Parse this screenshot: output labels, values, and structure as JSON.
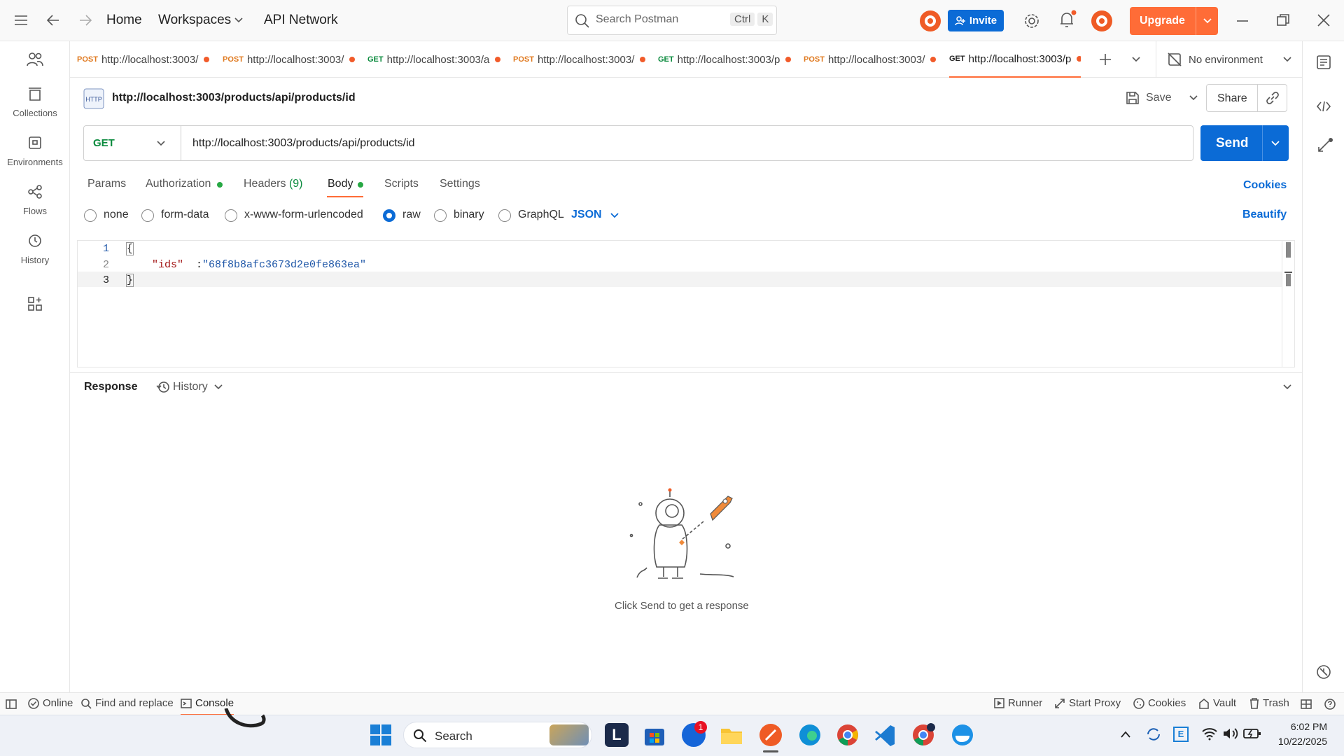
{
  "topbar": {
    "home": "Home",
    "workspaces": "Workspaces",
    "api_network": "API Network",
    "search_placeholder": "Search Postman",
    "search_key1": "Ctrl",
    "search_key2": "K",
    "invite": "Invite",
    "upgrade": "Upgrade"
  },
  "rail": {
    "items": [
      {
        "label": "Collections",
        "icon": "collections-icon"
      },
      {
        "label": "Environments",
        "icon": "environments-icon"
      },
      {
        "label": "Flows",
        "icon": "flows-icon"
      },
      {
        "label": "History",
        "icon": "history-icon"
      }
    ]
  },
  "tabs": [
    {
      "method": "POST",
      "url": "http://localhost:3003/"
    },
    {
      "method": "POST",
      "url": "http://localhost:3003/"
    },
    {
      "method": "GET",
      "url": "http://localhost:3003/a"
    },
    {
      "method": "POST",
      "url": "http://localhost:3003/"
    },
    {
      "method": "GET",
      "url": "http://localhost:3003/p"
    },
    {
      "method": "POST",
      "url": "http://localhost:3003/"
    },
    {
      "method": "GET",
      "url": "http://localhost:3003/p"
    }
  ],
  "environment": "No environment",
  "request": {
    "title": "http://localhost:3003/products/api/products/id",
    "save": "Save",
    "share": "Share",
    "method": "GET",
    "url": "http://localhost:3003/products/api/products/id",
    "send": "Send"
  },
  "subtabs": {
    "params": "Params",
    "authorization": "Authorization",
    "headers": "Headers",
    "headers_count": "(9)",
    "body": "Body",
    "scripts": "Scripts",
    "settings": "Settings",
    "cookies": "Cookies"
  },
  "body_types": {
    "none": "none",
    "form_data": "form-data",
    "urlencoded": "x-www-form-urlencoded",
    "raw": "raw",
    "binary": "binary",
    "graphql": "GraphQL",
    "format": "JSON",
    "beautify": "Beautify",
    "selected": "raw"
  },
  "editor": {
    "lines": [
      {
        "num": "1",
        "text": "{"
      },
      {
        "num": "2",
        "key": "\"ids\"",
        "sep": " : ",
        "value": "\"68f8b8afc3673d2e0fe863ea\""
      },
      {
        "num": "3",
        "text": "}"
      }
    ]
  },
  "response": {
    "label": "Response",
    "history": "History",
    "empty_text": "Click Send to get a response"
  },
  "statusbar": {
    "online": "Online",
    "find_replace": "Find and replace",
    "console": "Console",
    "runner": "Runner",
    "start_proxy": "Start Proxy",
    "cookies": "Cookies",
    "vault": "Vault",
    "trash": "Trash"
  },
  "taskbar": {
    "search": "Search",
    "badge": "1",
    "time": "6:02 PM",
    "date": "10/22/2025"
  },
  "colors": {
    "accent_orange": "#ff6c37",
    "send_blue": "#0b6bd6",
    "get_green": "#0a8a3d"
  }
}
